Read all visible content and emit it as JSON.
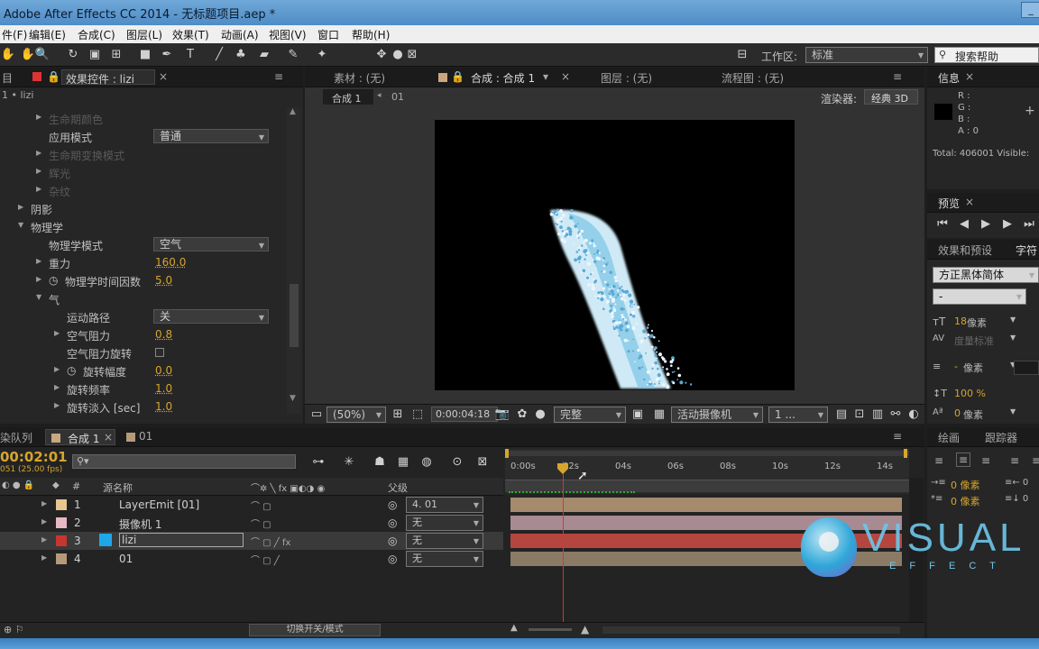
{
  "window": {
    "title": "Adobe After Effects CC 2014 - 无标题项目.aep *"
  },
  "menu": [
    "件(F)",
    "编辑(E)",
    "合成(C)",
    "图层(L)",
    "效果(T)",
    "动画(A)",
    "视图(V)",
    "窗口",
    "帮助(H)"
  ],
  "toolbar": {
    "workspace_label": "工作区:",
    "workspace_value": "标准",
    "search_placeholder": "搜索帮助"
  },
  "effects_panel": {
    "tab_label": "效果控件 : lizi",
    "layer_path": "1 • lizi",
    "rows": [
      {
        "label": "生命期颜色",
        "indent": 1,
        "dim": true
      },
      {
        "label": "应用模式",
        "indent": 1,
        "dropdown": "普通"
      },
      {
        "label": "生命期变换模式",
        "indent": 1,
        "dim": true
      },
      {
        "label": "辉光",
        "indent": 1,
        "dim": true
      },
      {
        "label": "杂纹",
        "indent": 1,
        "dim": true
      },
      {
        "label": "阴影",
        "indent": 0
      },
      {
        "label": "物理学",
        "indent": 0,
        "open": true
      },
      {
        "label": "物理学模式",
        "indent": 1,
        "dropdown": "空气"
      },
      {
        "label": "重力",
        "indent": 1,
        "value": "160.0"
      },
      {
        "label": "物理学时间因数",
        "indent": 1,
        "value": "5.0",
        "stopwatch": true
      },
      {
        "label": "气",
        "indent": 1,
        "open": true
      },
      {
        "label": "运动路径",
        "indent": 2,
        "dropdown": "关"
      },
      {
        "label": "空气阻力",
        "indent": 2,
        "value": "0.8"
      },
      {
        "label": "空气阻力旋转",
        "indent": 2,
        "checkbox": true
      },
      {
        "label": "旋转幅度",
        "indent": 2,
        "value": "0.0",
        "stopwatch": true
      },
      {
        "label": "旋转频率",
        "indent": 2,
        "value": "1.0"
      },
      {
        "label": "旋转淡入 [sec]",
        "indent": 2,
        "value": "1.0"
      }
    ]
  },
  "viewer": {
    "tab_footage": "素材 : (无)",
    "tab_comp": "合成 : 合成 1",
    "tab_layer": "图层 : (无)",
    "tab_flow": "流程图 : (无)",
    "breadcrumb_comp": "合成 1",
    "breadcrumb_next": "01",
    "renderer_label": "渲染器:",
    "renderer_value": "经典 3D",
    "zoom": "(50%)",
    "timecode": "0:00:04:18",
    "quality": "完整",
    "camera": "活动摄像机",
    "views": "1 ..."
  },
  "info_panel": {
    "tab": "信息",
    "r": "R :",
    "g": "G :",
    "b": "B :",
    "a": "A : 0",
    "total": "Total: 406001  Visible:"
  },
  "preview_panel": {
    "tab": "预览"
  },
  "char_panel": {
    "tab_effects": "效果和预设",
    "tab_char": "字符",
    "font": "方正黑体简体",
    "style": "-",
    "size_value": "18",
    "size_unit": "像素",
    "tracking_label": "度量标准",
    "leading_value": "-",
    "leading_unit": "像素",
    "vscale": "100 %",
    "baseline_value": "0",
    "baseline_unit": "像素"
  },
  "paint_panel": {
    "tab_paint": "绘画",
    "tab_tracker": "跟踪器",
    "indent_a": "0 像素",
    "indent_b": "0 像素"
  },
  "timeline": {
    "tab_queue": "染队列",
    "tab_comp": "合成 1",
    "tab_01": "01",
    "timecode": "00:02:01",
    "fps": "051 (25.00 fps)",
    "col_source": "源名称",
    "col_parent": "父级",
    "col_num": "#",
    "ruler": [
      "0:00s",
      "02s",
      "04s",
      "06s",
      "08s",
      "10s",
      "12s",
      "14s"
    ],
    "toggle_label": "切换开关/模式",
    "layers": [
      {
        "num": "1",
        "name": "LayerEmit [01]",
        "color": "#e7c68f",
        "parent": "4. 01",
        "bar": "#a58a6e"
      },
      {
        "num": "2",
        "name": "摄像机 1",
        "color": "#e7b8c4",
        "parent": "无",
        "bar": "#a88a92"
      },
      {
        "num": "3",
        "name": "lizi",
        "color": "#c8352f",
        "parent": "无",
        "bar": "#b4463f",
        "selected": true
      },
      {
        "num": "4",
        "name": "01",
        "color": "#b59a7a",
        "parent": "无",
        "bar": "#8b7a66"
      }
    ]
  },
  "watermark": {
    "text": "VISUAL",
    "sub": "E F F E C T"
  }
}
